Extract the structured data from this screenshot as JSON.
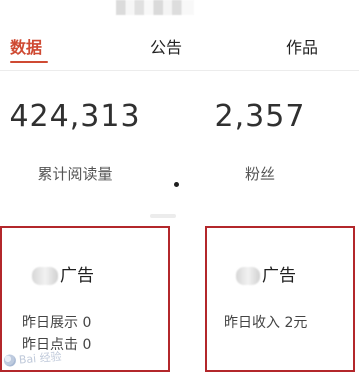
{
  "tabs": {
    "items": [
      {
        "label": "数据",
        "active": true
      },
      {
        "label": "公告",
        "active": false
      },
      {
        "label": "作品",
        "active": false
      }
    ],
    "accent_color": "#cf4a33"
  },
  "stats": {
    "total_reads": {
      "value": "424,313",
      "label": "累计阅读量"
    },
    "followers": {
      "value": "2,357",
      "label": "粉丝"
    }
  },
  "cards": {
    "left": {
      "title_prefix": "",
      "title_suffix": "广告",
      "metrics": [
        "昨日展示 0",
        "昨日点击 0"
      ],
      "border_color": "#b3272b"
    },
    "right": {
      "title_prefix": "",
      "title_suffix": "广告",
      "metric": "昨日收入 2元",
      "border_color": "#b3272b"
    }
  },
  "watermark": {
    "text": "Bai 经验"
  }
}
